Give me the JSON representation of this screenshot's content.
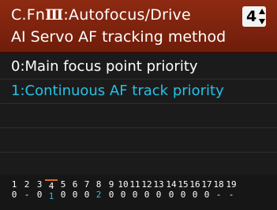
{
  "header": {
    "title_prefix": "C.Fn",
    "title_group": "Ⅲ",
    "title_suffix": ":Autofocus/Drive",
    "subtitle": "AI Servo AF tracking method",
    "page_number": "4"
  },
  "options": [
    {
      "label": "0:Main focus point priority",
      "selected": false
    },
    {
      "label": "1:Continuous AF track priority",
      "selected": true
    }
  ],
  "status": {
    "numbers": [
      "1",
      "2",
      "3",
      "4",
      "5",
      "6",
      "7",
      "8",
      "9",
      "10",
      "11",
      "12",
      "13",
      "14",
      "15",
      "16",
      "17",
      "18",
      "19"
    ],
    "values": [
      "0",
      "-",
      "0",
      "1",
      "0",
      "0",
      "0",
      "2",
      "0",
      "0",
      "0",
      "0",
      "0",
      "0",
      "0",
      "0",
      "0",
      "-",
      "-"
    ],
    "current_index": 3,
    "highlight_indices": [
      3,
      7
    ]
  },
  "colors": {
    "header_bg": "#7a220c",
    "selected_text": "#25c2e6",
    "current_marker": "#e06a24"
  }
}
